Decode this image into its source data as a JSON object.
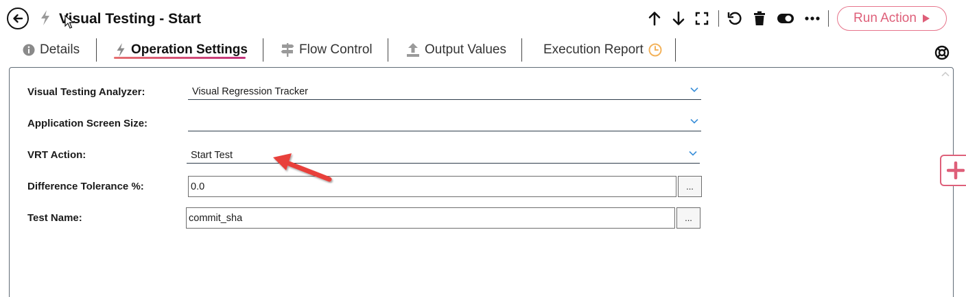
{
  "header": {
    "title": "Visual Testing - Start",
    "back_icon": "arrow-left-circle-icon",
    "action_icon": "lightning-bolt-icon",
    "toolbar": [
      {
        "name": "move-up-icon"
      },
      {
        "name": "move-down-icon"
      },
      {
        "name": "expand-icon"
      },
      {
        "name": "undo-icon"
      },
      {
        "name": "trash-icon"
      },
      {
        "name": "toggle-icon"
      },
      {
        "name": "more-icon"
      }
    ],
    "run_button_label": "Run Action"
  },
  "tabs": [
    {
      "label": "Details",
      "icon": "info-icon",
      "active": false
    },
    {
      "label": "Operation Settings",
      "icon": "lightning-bolt-icon",
      "active": true
    },
    {
      "label": "Flow Control",
      "icon": "signpost-icon",
      "active": false
    },
    {
      "label": "Output Values",
      "icon": "upload-icon",
      "active": false
    },
    {
      "label": "Execution Report",
      "icon": "clock-icon",
      "active": false
    }
  ],
  "help_icon": "lifebuoy-icon",
  "form": {
    "analyzer": {
      "label": "Visual Testing Analyzer:",
      "value": "Visual Regression Tracker"
    },
    "screen_size": {
      "label": "Application Screen Size:",
      "value": ""
    },
    "vrt_action": {
      "label": "VRT Action:",
      "value": "Start Test"
    },
    "tolerance": {
      "label": "Difference Tolerance %:",
      "value": "0.0",
      "button": "..."
    },
    "test_name": {
      "label": "Test Name:",
      "value": "commit_sha",
      "button": "..."
    }
  },
  "colors": {
    "accent": "#de5f79",
    "underline_start": "#e66f6f",
    "underline_end": "#c2307a",
    "chevron": "#3a8fd9",
    "clock": "#f3b25a",
    "annotation_arrow": "#e8413a"
  }
}
